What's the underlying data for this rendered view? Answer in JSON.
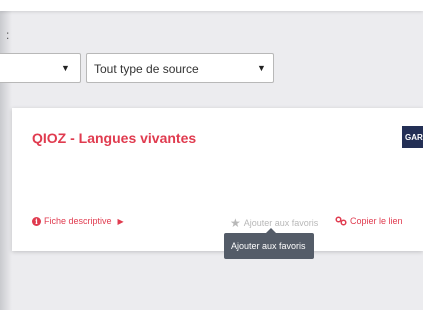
{
  "filters": {
    "colon": ":",
    "select_1": {
      "value": ""
    },
    "select_2": {
      "value": "Tout type de source"
    }
  },
  "card": {
    "title": "QIOZ - Langues vivantes",
    "badge": "GAR",
    "fiche_label": "Fiche descriptive",
    "favorite_label": "Ajouter aux favoris",
    "copy_link_label": "Copier le lien"
  },
  "tooltip": {
    "text": "Ajouter aux favoris"
  },
  "colors": {
    "accent": "#e03b4f",
    "badge": "#232f55",
    "tooltip": "#545c68",
    "muted": "#b8b8b8"
  }
}
